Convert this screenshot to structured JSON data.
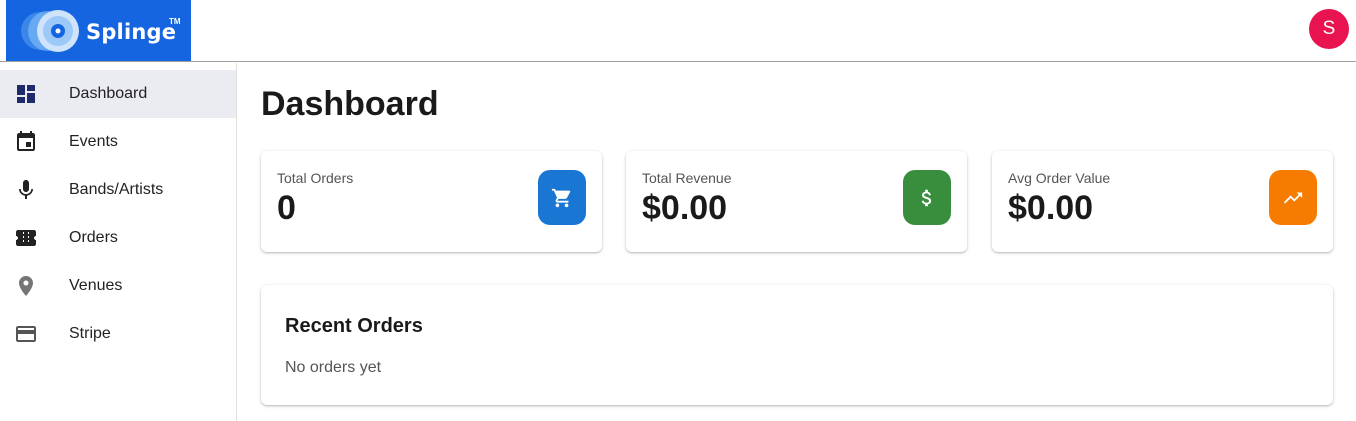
{
  "brand": {
    "name": "Splinge",
    "trademark": "TM",
    "color": "#1565e0"
  },
  "user": {
    "avatar_initial": "S",
    "avatar_color": "#e8134f"
  },
  "sidebar": {
    "items": [
      {
        "label": "Dashboard",
        "icon": "dashboard-icon",
        "active": true
      },
      {
        "label": "Events",
        "icon": "calendar-icon"
      },
      {
        "label": "Bands/Artists",
        "icon": "microphone-icon"
      },
      {
        "label": "Orders",
        "icon": "ticket-icon"
      },
      {
        "label": "Venues",
        "icon": "location-pin-icon"
      },
      {
        "label": "Stripe",
        "icon": "credit-card-icon"
      }
    ]
  },
  "main": {
    "title": "Dashboard",
    "stats": [
      {
        "label": "Total Orders",
        "value": "0",
        "icon": "shopping-cart-icon",
        "color": "#1976d2"
      },
      {
        "label": "Total Revenue",
        "value": "$0.00",
        "icon": "dollar-icon",
        "color": "#388e3c"
      },
      {
        "label": "Avg Order Value",
        "value": "$0.00",
        "icon": "trending-up-icon",
        "color": "#f57c00"
      }
    ],
    "recent_orders": {
      "title": "Recent Orders",
      "empty_text": "No orders yet"
    }
  }
}
